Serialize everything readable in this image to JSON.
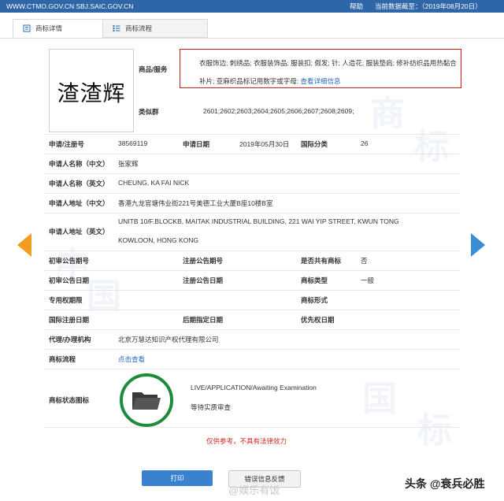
{
  "topbar": {
    "site": "WWW.CTMO.GOV.CN SBJ.SAIC.GOV.CN",
    "help": "帮助",
    "date": "当前数据截至：（2019年08月20日）"
  },
  "tabs": {
    "detail": "商标详情",
    "flow": "商标流程"
  },
  "mark": {
    "text": "渣渣辉"
  },
  "goods": {
    "label": "商品/服务",
    "text": "衣服饰边; 刺绣品; 衣服装饰品; 服装扣; 假发; 针; 人造花; 服装垫肩; 修补纺织品用热黏合补片; 亚麻织品标记用数字或字母;",
    "link": "查看详细信息"
  },
  "similar": {
    "label": "类似群",
    "value": "2601;2602;2603;2604;2605;2606;2607;2608;2609;"
  },
  "reg": {
    "no_label": "申请/注册号",
    "no_value": "38569119",
    "date_label": "申请日期",
    "date_value": "2019年05月30日",
    "class_label": "国际分类",
    "class_value": "26"
  },
  "applicant_cn": {
    "label": "申请人名称（中文）",
    "value": "张家辉"
  },
  "applicant_en": {
    "label": "申请人名称（英文）",
    "value": "CHEUNG, KA FAI NICK"
  },
  "address_cn": {
    "label": "申请人地址（中文）",
    "value": "香港九龙官塘伟业街221号美德工业大厦B座10楼B室"
  },
  "address_en": {
    "label": "申请人地址（英文）",
    "line1": "UNITB 10/F.BLOCKB, MAITAK INDUSTRIAL BUILDING, 221 WAI YIP STREET, KWUN TONG",
    "line2": "KOWLOON, HONG KONG"
  },
  "row_prelim": {
    "l1": "初审公告期号",
    "l2": "注册公告期号",
    "l3": "是否共有商标",
    "v3": "否"
  },
  "row_dates": {
    "l1": "初审公告日期",
    "l2": "注册公告日期",
    "l3": "商标类型",
    "v3": "一般"
  },
  "row_excl": {
    "l1": "专用权期限",
    "l3": "商标形式"
  },
  "row_intl": {
    "l1": "国际注册日期",
    "l2": "后期指定日期",
    "l3": "优先权日期"
  },
  "agent": {
    "label": "代理/办理机构",
    "value": "北京万慧达知识产权代理有限公司"
  },
  "flow": {
    "label": "商标流程",
    "link": "点击查看"
  },
  "status": {
    "label": "商标状态图标",
    "en": "LIVE/APPLICATION/Awaiting Examination",
    "cn": "等待实质审查"
  },
  "disclaimer": "仅供参考，不具有法律效力",
  "buttons": {
    "print": "打印",
    "feedback": "错误信息反馈"
  },
  "watermark": "@娱乐有饭",
  "brand": "头条 @衰兵必胜",
  "colors": {
    "topbar": "#2f66a8",
    "accent_red": "#d01c1c",
    "status_green": "#1e8a3c",
    "link": "#2a6bbf",
    "arrow_left": "#f39c22",
    "arrow_right": "#3b8dd6"
  }
}
